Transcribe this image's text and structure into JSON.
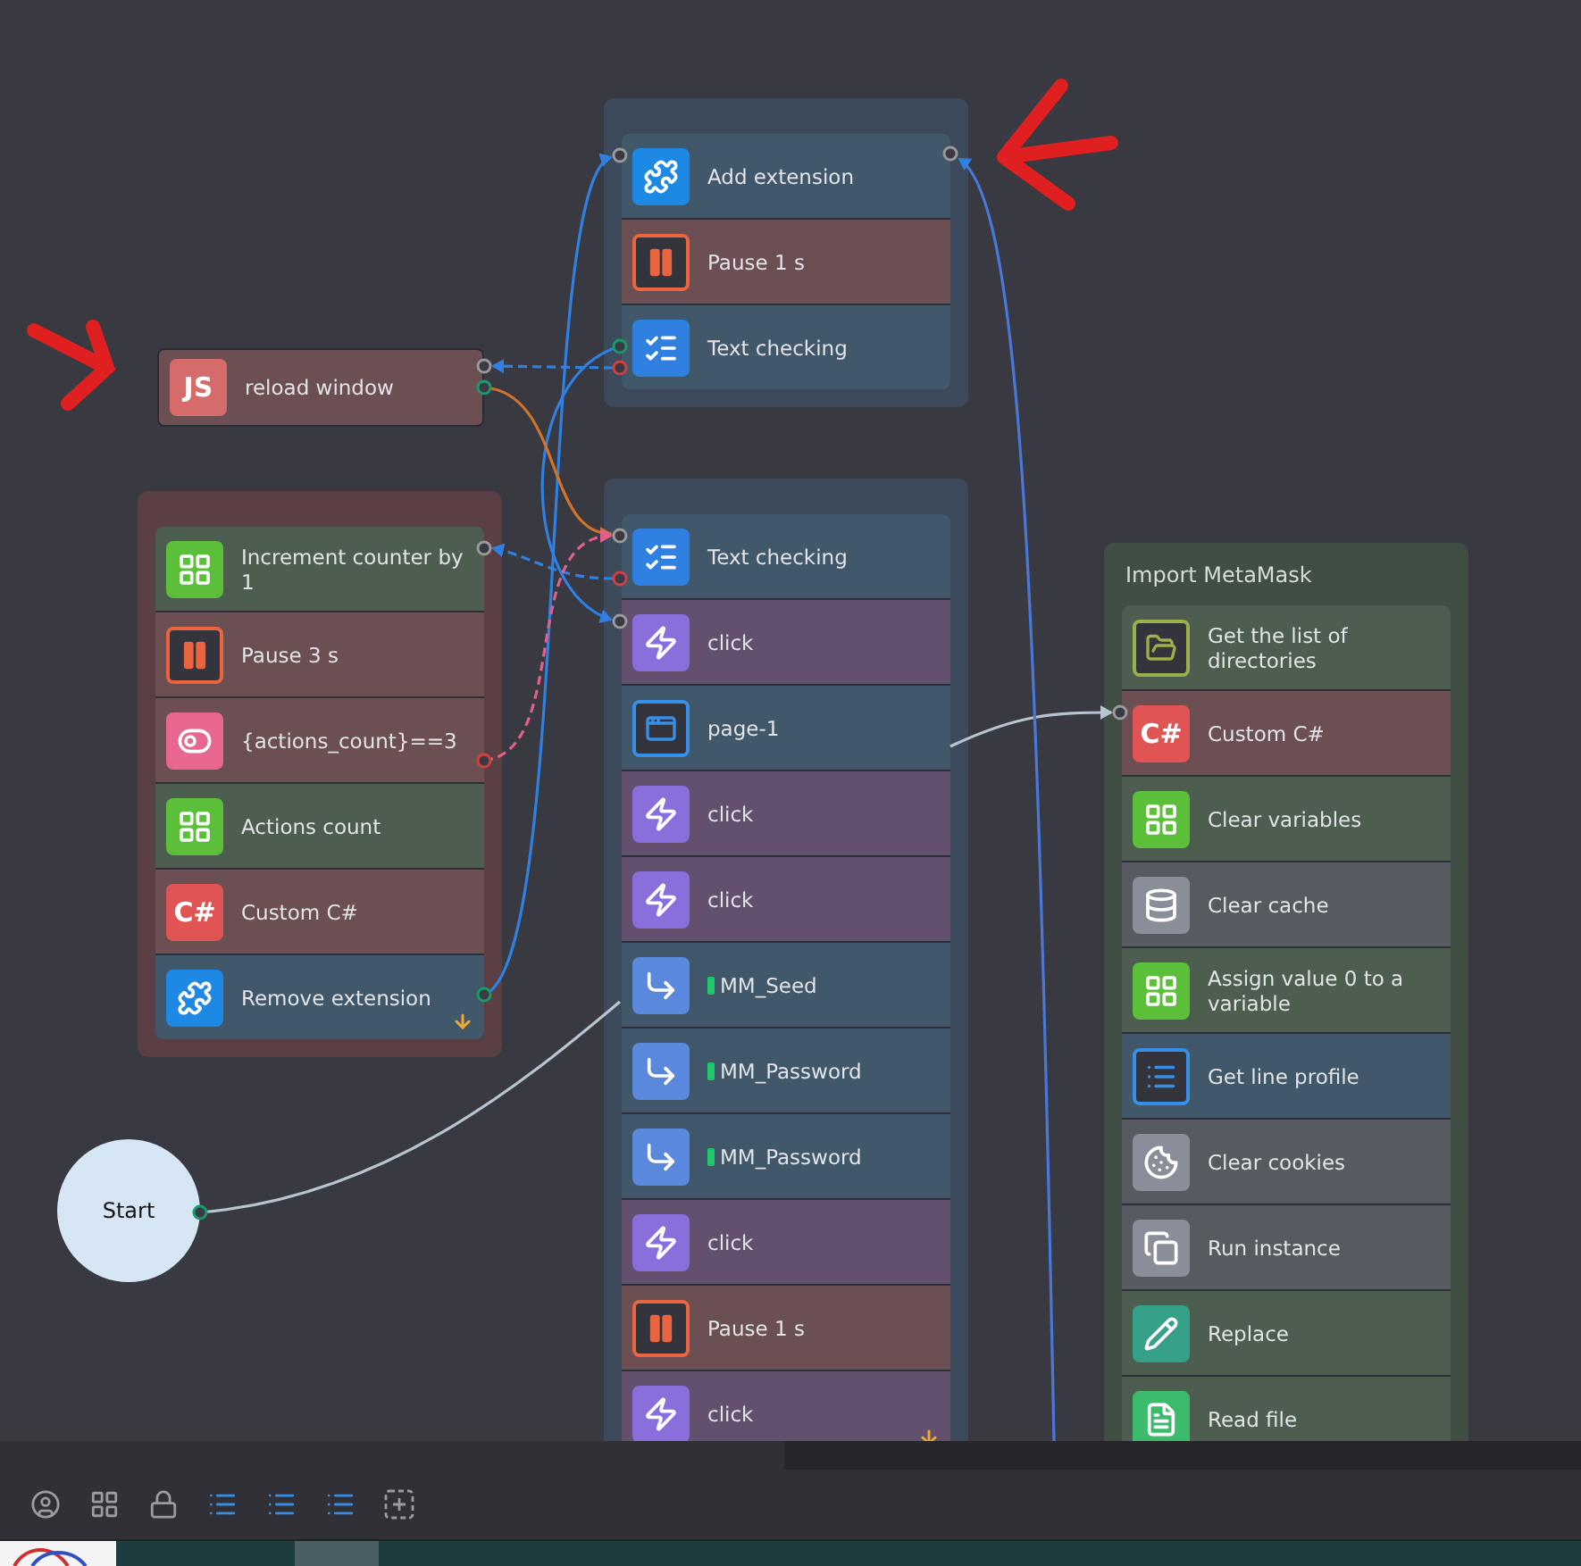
{
  "groups": [
    {
      "rows": [
        {
          "kind": "extension",
          "label": "Add extension"
        },
        {
          "kind": "pause",
          "label": "Pause 1 s"
        },
        {
          "kind": "text-check",
          "label": "Text checking"
        }
      ]
    },
    {
      "rows": [
        {
          "kind": "variable",
          "label": "Increment counter by 1"
        },
        {
          "kind": "pause",
          "label": "Pause 3 s"
        },
        {
          "kind": "condition",
          "label": "{actions_count}==3"
        },
        {
          "kind": "variable",
          "label": "Actions count"
        },
        {
          "kind": "csharp",
          "icon_text": "C#",
          "label": "Custom C#"
        },
        {
          "kind": "extension",
          "label": "Remove extension"
        }
      ],
      "end_marker": true
    },
    {
      "rows": [
        {
          "kind": "text-check",
          "label": "Text checking"
        },
        {
          "kind": "click",
          "label": "click"
        },
        {
          "kind": "page",
          "label": "page-1"
        },
        {
          "kind": "click",
          "label": "click"
        },
        {
          "kind": "click",
          "label": "click"
        },
        {
          "kind": "input",
          "label": "MM_Seed"
        },
        {
          "kind": "input",
          "label": "MM_Password"
        },
        {
          "kind": "input",
          "label": "MM_Password"
        },
        {
          "kind": "click",
          "label": "click"
        },
        {
          "kind": "pause",
          "label": "Pause 1 s"
        },
        {
          "kind": "click",
          "label": "click"
        }
      ],
      "end_marker": true
    },
    {
      "title": "Import MetaMask",
      "rows": [
        {
          "kind": "folder",
          "label": "Get the list of directories"
        },
        {
          "kind": "csharp",
          "icon_text": "C#",
          "label": "Custom C#"
        },
        {
          "kind": "variable",
          "label": "Clear variables"
        },
        {
          "kind": "cache",
          "label": "Clear cache"
        },
        {
          "kind": "variable",
          "label": "Assign value 0 to a variable"
        },
        {
          "kind": "list",
          "label": "Get line profile"
        },
        {
          "kind": "cookies",
          "label": "Clear cookies"
        },
        {
          "kind": "instance",
          "label": "Run instance"
        },
        {
          "kind": "replace",
          "label": "Replace"
        },
        {
          "kind": "file",
          "label": "Read file"
        }
      ]
    }
  ],
  "node": {
    "kind": "js",
    "icon_text": "JS",
    "label": "reload window"
  },
  "start": {
    "label": "Start"
  }
}
